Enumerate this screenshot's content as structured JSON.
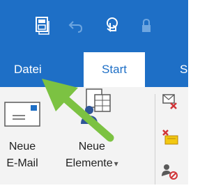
{
  "quick_access": [
    {
      "icon": "save-icon"
    },
    {
      "icon": "undo-icon"
    },
    {
      "icon": "touch-mode-icon"
    },
    {
      "icon": "lock-icon"
    }
  ],
  "tabs": [
    {
      "label": "Datei"
    },
    {
      "label": "Start",
      "selected": true
    },
    {
      "label": "Se"
    }
  ],
  "ribbon": {
    "new_email": {
      "line1": "Neue",
      "line2": "E-Mail",
      "icon": "envelope-icon"
    },
    "new_items": {
      "line1": "Neue",
      "line2": "Elemente",
      "dropdown": "▾",
      "icon": "new-items-icon"
    },
    "side_buttons": [
      {
        "icon": "ignore-icon"
      },
      {
        "icon": "cleanup-icon"
      },
      {
        "icon": "junk-icon"
      }
    ]
  },
  "colors": {
    "titlebar": "#1e6fc6",
    "ribbon_bg": "#f3f3f3",
    "annotation_arrow": "#7cc242"
  }
}
